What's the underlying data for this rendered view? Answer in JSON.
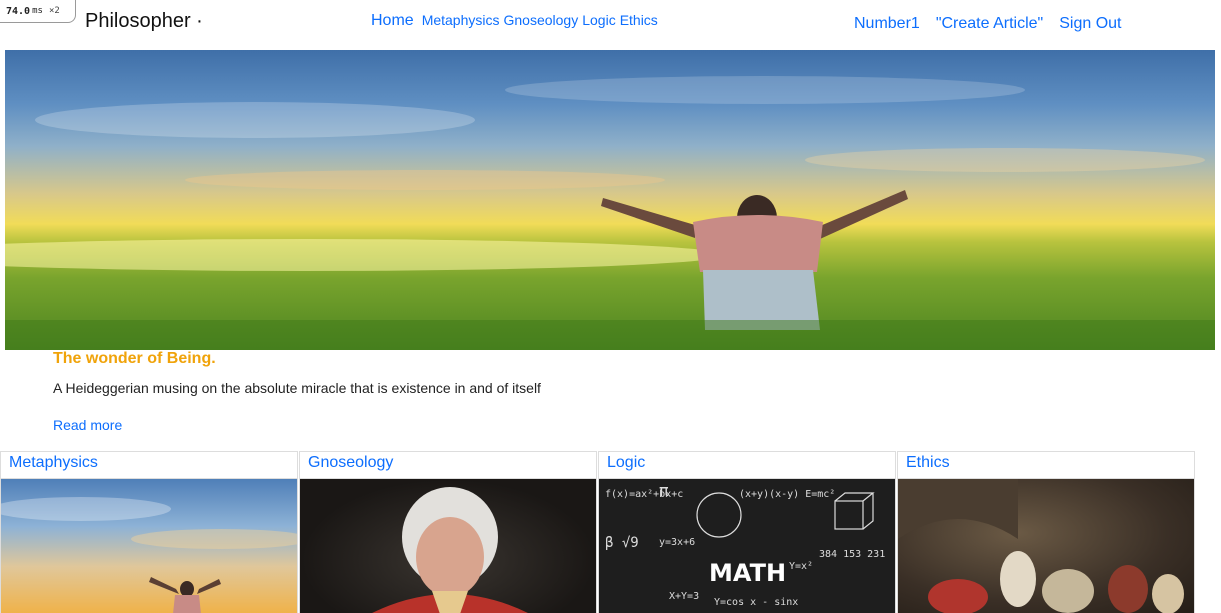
{
  "perf_badge": {
    "time": "74.0",
    "unit": "ms",
    "multiplier": "×2"
  },
  "navbar": {
    "brand": "Philosopher ·",
    "home": "Home",
    "categories": [
      "Metaphysics",
      "Gnoseology",
      "Logic",
      "Ethics"
    ],
    "right": [
      "Number1",
      "\"Create Article\"",
      "Sign Out"
    ]
  },
  "feature": {
    "title": "The wonder of Being.",
    "description": "A Heideggerian musing on the absolute miracle that is existence in and of itself",
    "link": "Read more"
  },
  "cards": [
    {
      "title": "Metaphysics"
    },
    {
      "title": "Gnoseology"
    },
    {
      "title": "Logic",
      "board_text": "MATH"
    },
    {
      "title": "Ethics"
    }
  ],
  "colors": {
    "link": "#0d6efd",
    "feature_title": "#f0a30a"
  }
}
